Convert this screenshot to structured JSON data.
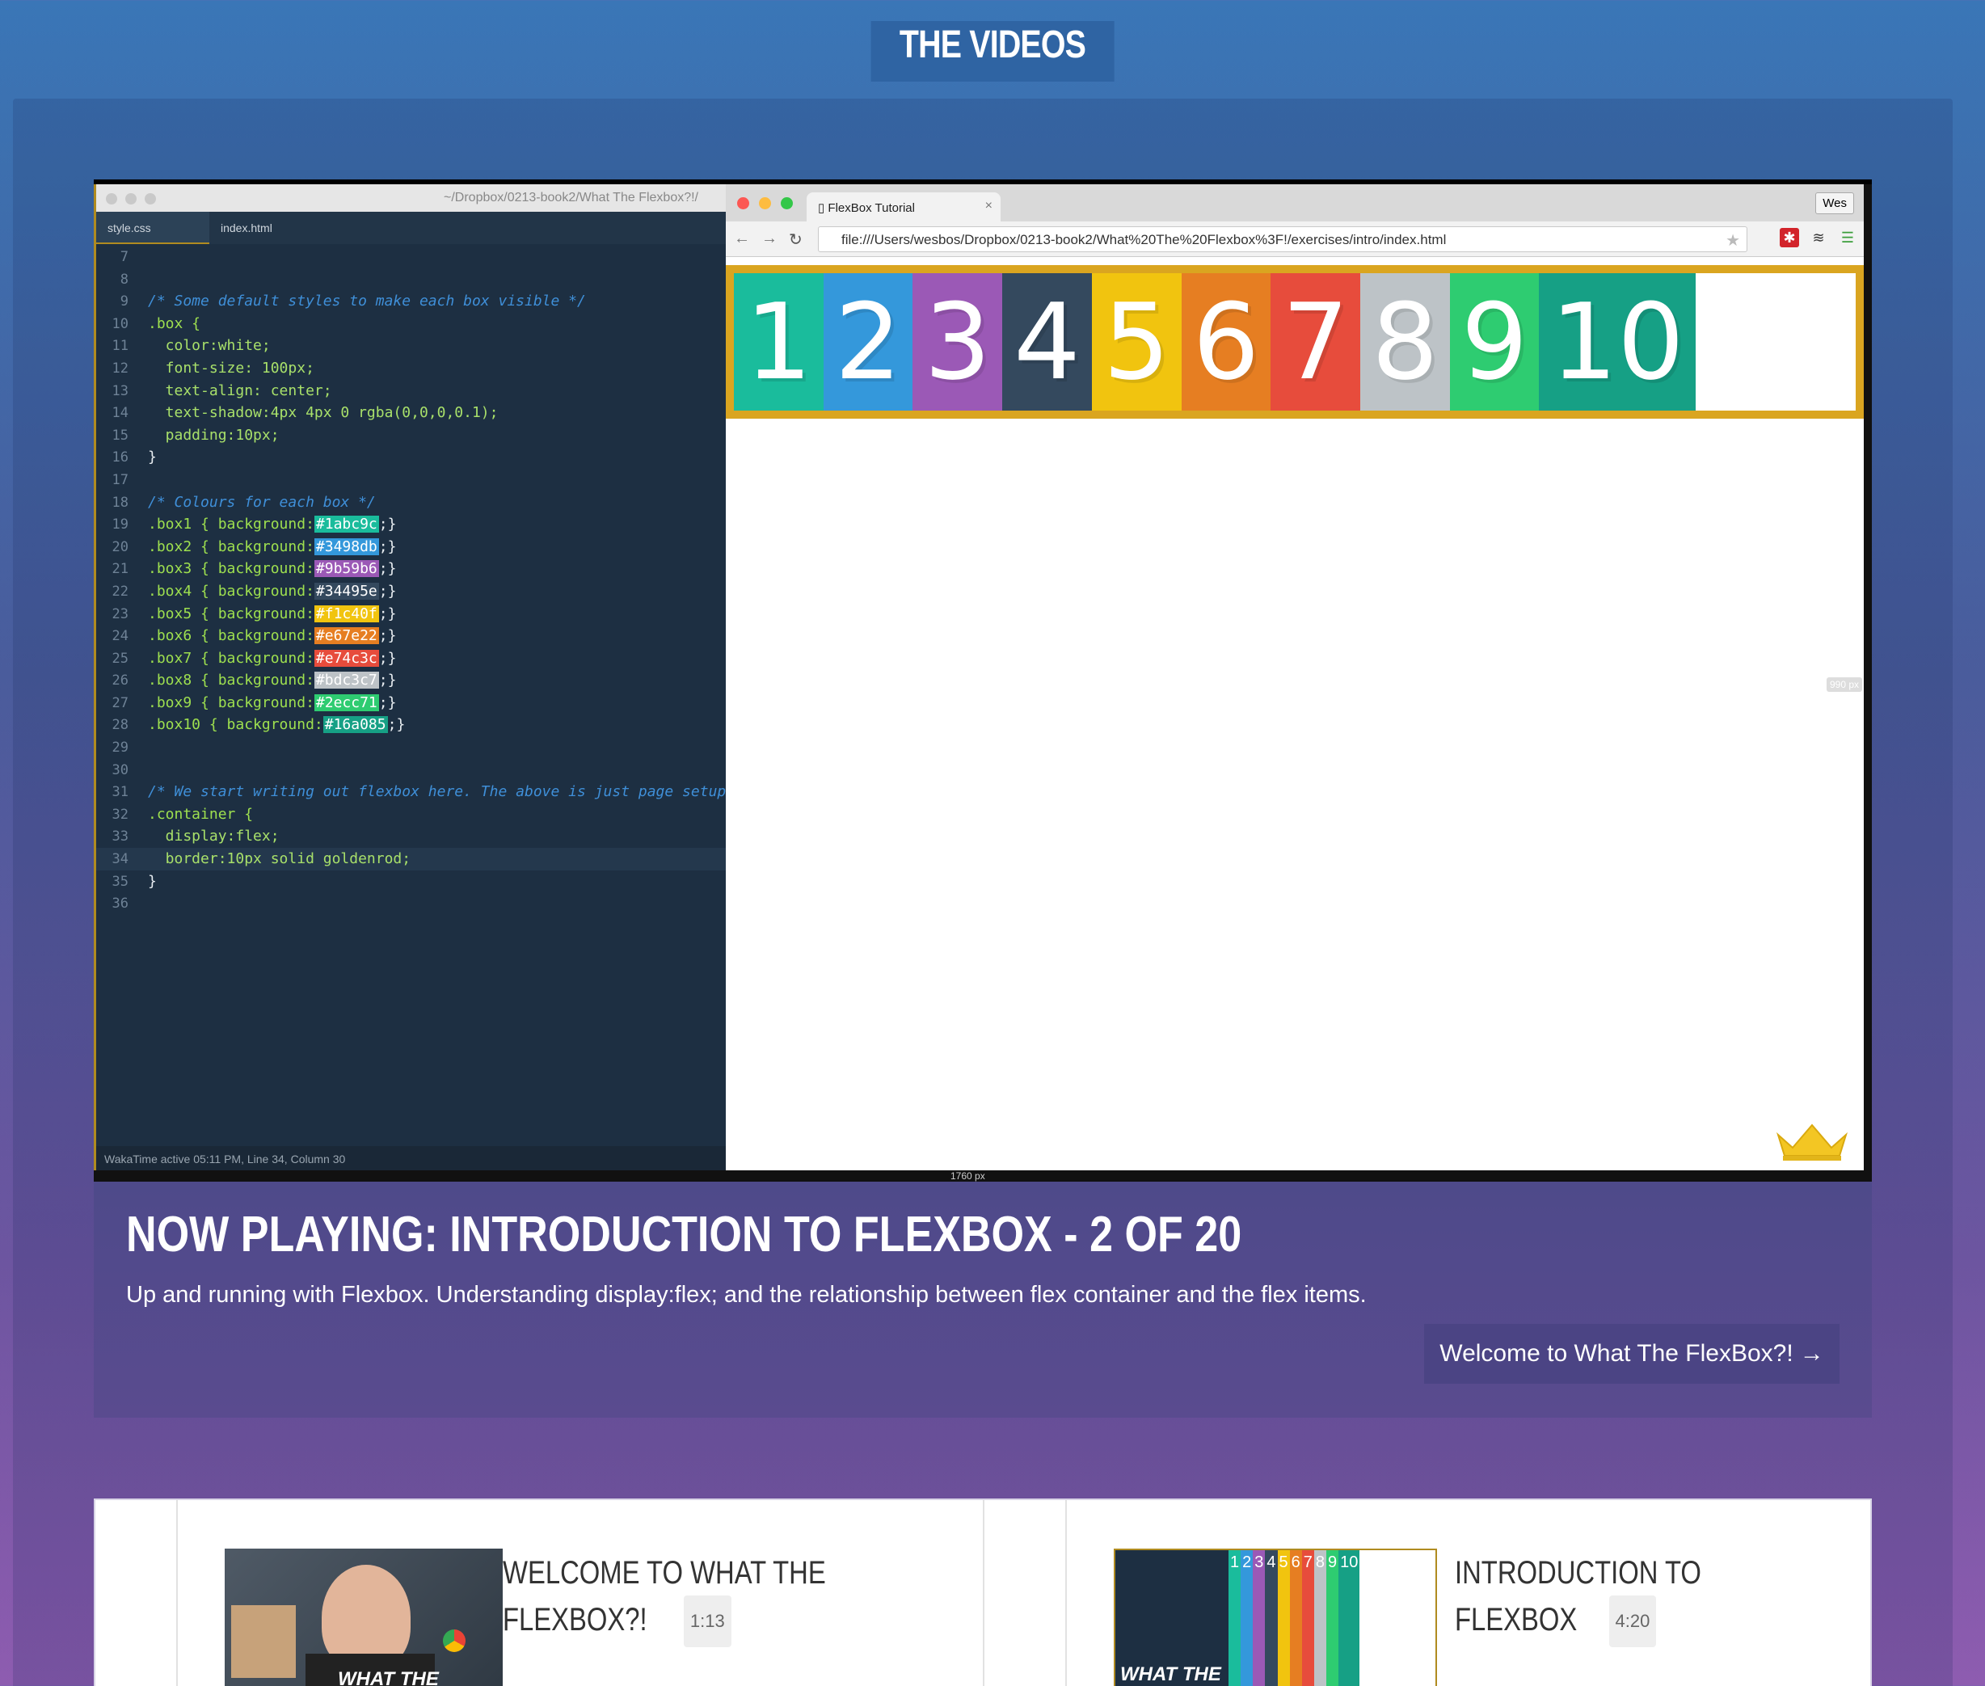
{
  "page": {
    "heading": "THE VIDEOS"
  },
  "editor": {
    "path": "~/Dropbox/0213-book2/What The Flexbox?!/",
    "tabs": [
      "style.css",
      "index.html"
    ],
    "lines": [
      {
        "n": "7",
        "t": ""
      },
      {
        "n": "8",
        "t": ""
      },
      {
        "n": "9",
        "t": "/* Some default styles to make each box visible */"
      },
      {
        "n": "10",
        "t": ".box {"
      },
      {
        "n": "11",
        "t": "  color:white;"
      },
      {
        "n": "12",
        "t": "  font-size: 100px;"
      },
      {
        "n": "13",
        "t": "  text-align: center;"
      },
      {
        "n": "14",
        "t": "  text-shadow:4px 4px 0 rgba(0,0,0,0.1);"
      },
      {
        "n": "15",
        "t": "  padding:10px;"
      },
      {
        "n": "16",
        "t": "}"
      },
      {
        "n": "17",
        "t": ""
      },
      {
        "n": "18",
        "t": "/* Colours for each box */"
      },
      {
        "n": "19",
        "t": ".box1 { background:#1abc9c;}"
      },
      {
        "n": "20",
        "t": ".box2 { background:#3498db;}"
      },
      {
        "n": "21",
        "t": ".box3 { background:#9b59b6;}"
      },
      {
        "n": "22",
        "t": ".box4 { background:#34495e;}"
      },
      {
        "n": "23",
        "t": ".box5 { background:#f1c40f;}"
      },
      {
        "n": "24",
        "t": ".box6 { background:#e67e22;}"
      },
      {
        "n": "25",
        "t": ".box7 { background:#e74c3c;}"
      },
      {
        "n": "26",
        "t": ".box8 { background:#bdc3c7;}"
      },
      {
        "n": "27",
        "t": ".box9 { background:#2ecc71;}"
      },
      {
        "n": "28",
        "t": ".box10 { background:#16a085;}"
      },
      {
        "n": "29",
        "t": ""
      },
      {
        "n": "30",
        "t": ""
      },
      {
        "n": "31",
        "t": "/* We start writing out flexbox here. The above is just page setup"
      },
      {
        "n": "32",
        "t": ".container {"
      },
      {
        "n": "33",
        "t": "  display:flex;"
      },
      {
        "n": "34",
        "t": "  border:10px solid goldenrod;"
      },
      {
        "n": "35",
        "t": "}"
      },
      {
        "n": "36",
        "t": ""
      }
    ],
    "status": "WakaTime active 05:11 PM, Line 34, Column 30"
  },
  "browser": {
    "tab_title": "FlexBox Tutorial",
    "tab_close": "×",
    "profile": "Wes",
    "url": "file:///Users/wesbos/Dropbox/0213-book2/What%20The%20Flexbox%3F!/exercises/intro/index.html",
    "px_height": "990 px",
    "px_width": "1760 px",
    "boxes": [
      {
        "label": "1",
        "color": "#1abc9c"
      },
      {
        "label": "2",
        "color": "#3498db"
      },
      {
        "label": "3",
        "color": "#9b59b6"
      },
      {
        "label": "4",
        "color": "#34495e"
      },
      {
        "label": "5",
        "color": "#f1c40f"
      },
      {
        "label": "6",
        "color": "#e67e22"
      },
      {
        "label": "7",
        "color": "#e74c3c"
      },
      {
        "label": "8",
        "color": "#bdc3c7"
      },
      {
        "label": "9",
        "color": "#2ecc71"
      },
      {
        "label": "10",
        "color": "#16a085"
      }
    ]
  },
  "info": {
    "now_playing": "NOW PLAYING: INTRODUCTION TO FLEXBOX - 2 OF 20",
    "description": "Up and running with Flexbox. Understanding display:flex; and the relationship between flex container and the flex items.",
    "next_label": "Welcome to What The FlexBox?!",
    "next_arrow": "→"
  },
  "playlist": [
    {
      "title_line1": "WELCOME TO WHAT THE",
      "title_line2": "FLEXBOX?!",
      "duration": "1:13",
      "thumb_text": "WHAT THE"
    },
    {
      "title_line1": "INTRODUCTION TO",
      "title_line2": "FLEXBOX",
      "duration": "4:20",
      "thumb_text": "WHAT THE",
      "thumb_digits": "12345678910"
    }
  ]
}
